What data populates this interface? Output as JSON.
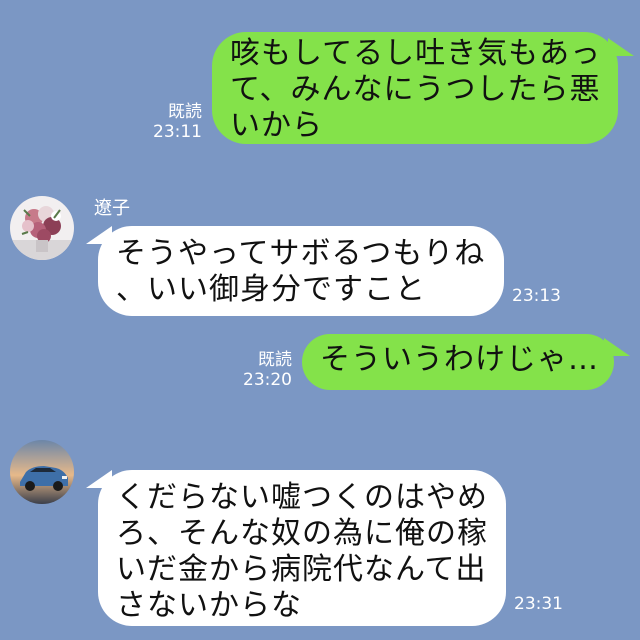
{
  "messages": [
    {
      "direction": "outgoing",
      "lines": [
        "咳もしてるし吐き気もあっ",
        "て、みんなにうつしたら悪",
        "いから"
      ],
      "read_label": "既読",
      "time": "23:11"
    },
    {
      "direction": "incoming",
      "sender": "遼子",
      "avatar": "flower-bouquet-avatar",
      "lines": [
        "そうやってサボるつもりね",
        "、いい御身分ですこと"
      ],
      "time": "23:13"
    },
    {
      "direction": "outgoing",
      "lines": [
        "そういうわけじゃ…"
      ],
      "read_label": "既読",
      "time": "23:20"
    },
    {
      "direction": "incoming",
      "avatar": "car-avatar",
      "lines": [
        "くだらない嘘つくのはやめ",
        "ろ、そんな奴の為に俺の稼",
        "いだ金から病院代なんて出",
        "さないからな"
      ],
      "time": "23:31"
    }
  ],
  "colors": {
    "background": "#7b97c4",
    "outgoing_bubble": "#84e24a",
    "incoming_bubble": "#ffffff",
    "meta_text": "#ffffff"
  }
}
